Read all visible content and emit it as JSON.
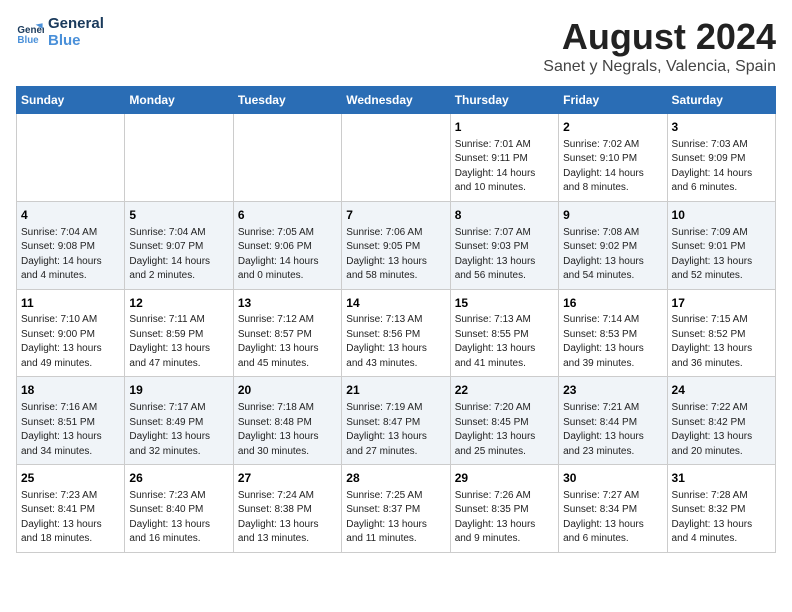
{
  "header": {
    "logo_line1": "General",
    "logo_line2": "Blue",
    "main_title": "August 2024",
    "subtitle": "Sanet y Negrals, Valencia, Spain"
  },
  "days_of_week": [
    "Sunday",
    "Monday",
    "Tuesday",
    "Wednesday",
    "Thursday",
    "Friday",
    "Saturday"
  ],
  "weeks": [
    {
      "row_class": "",
      "days": [
        {
          "num": "",
          "info": ""
        },
        {
          "num": "",
          "info": ""
        },
        {
          "num": "",
          "info": ""
        },
        {
          "num": "",
          "info": ""
        },
        {
          "num": "1",
          "info": "Sunrise: 7:01 AM\nSunset: 9:11 PM\nDaylight: 14 hours\nand 10 minutes."
        },
        {
          "num": "2",
          "info": "Sunrise: 7:02 AM\nSunset: 9:10 PM\nDaylight: 14 hours\nand 8 minutes."
        },
        {
          "num": "3",
          "info": "Sunrise: 7:03 AM\nSunset: 9:09 PM\nDaylight: 14 hours\nand 6 minutes."
        }
      ]
    },
    {
      "row_class": "alt-row",
      "days": [
        {
          "num": "4",
          "info": "Sunrise: 7:04 AM\nSunset: 9:08 PM\nDaylight: 14 hours\nand 4 minutes."
        },
        {
          "num": "5",
          "info": "Sunrise: 7:04 AM\nSunset: 9:07 PM\nDaylight: 14 hours\nand 2 minutes."
        },
        {
          "num": "6",
          "info": "Sunrise: 7:05 AM\nSunset: 9:06 PM\nDaylight: 14 hours\nand 0 minutes."
        },
        {
          "num": "7",
          "info": "Sunrise: 7:06 AM\nSunset: 9:05 PM\nDaylight: 13 hours\nand 58 minutes."
        },
        {
          "num": "8",
          "info": "Sunrise: 7:07 AM\nSunset: 9:03 PM\nDaylight: 13 hours\nand 56 minutes."
        },
        {
          "num": "9",
          "info": "Sunrise: 7:08 AM\nSunset: 9:02 PM\nDaylight: 13 hours\nand 54 minutes."
        },
        {
          "num": "10",
          "info": "Sunrise: 7:09 AM\nSunset: 9:01 PM\nDaylight: 13 hours\nand 52 minutes."
        }
      ]
    },
    {
      "row_class": "",
      "days": [
        {
          "num": "11",
          "info": "Sunrise: 7:10 AM\nSunset: 9:00 PM\nDaylight: 13 hours\nand 49 minutes."
        },
        {
          "num": "12",
          "info": "Sunrise: 7:11 AM\nSunset: 8:59 PM\nDaylight: 13 hours\nand 47 minutes."
        },
        {
          "num": "13",
          "info": "Sunrise: 7:12 AM\nSunset: 8:57 PM\nDaylight: 13 hours\nand 45 minutes."
        },
        {
          "num": "14",
          "info": "Sunrise: 7:13 AM\nSunset: 8:56 PM\nDaylight: 13 hours\nand 43 minutes."
        },
        {
          "num": "15",
          "info": "Sunrise: 7:13 AM\nSunset: 8:55 PM\nDaylight: 13 hours\nand 41 minutes."
        },
        {
          "num": "16",
          "info": "Sunrise: 7:14 AM\nSunset: 8:53 PM\nDaylight: 13 hours\nand 39 minutes."
        },
        {
          "num": "17",
          "info": "Sunrise: 7:15 AM\nSunset: 8:52 PM\nDaylight: 13 hours\nand 36 minutes."
        }
      ]
    },
    {
      "row_class": "alt-row",
      "days": [
        {
          "num": "18",
          "info": "Sunrise: 7:16 AM\nSunset: 8:51 PM\nDaylight: 13 hours\nand 34 minutes."
        },
        {
          "num": "19",
          "info": "Sunrise: 7:17 AM\nSunset: 8:49 PM\nDaylight: 13 hours\nand 32 minutes."
        },
        {
          "num": "20",
          "info": "Sunrise: 7:18 AM\nSunset: 8:48 PM\nDaylight: 13 hours\nand 30 minutes."
        },
        {
          "num": "21",
          "info": "Sunrise: 7:19 AM\nSunset: 8:47 PM\nDaylight: 13 hours\nand 27 minutes."
        },
        {
          "num": "22",
          "info": "Sunrise: 7:20 AM\nSunset: 8:45 PM\nDaylight: 13 hours\nand 25 minutes."
        },
        {
          "num": "23",
          "info": "Sunrise: 7:21 AM\nSunset: 8:44 PM\nDaylight: 13 hours\nand 23 minutes."
        },
        {
          "num": "24",
          "info": "Sunrise: 7:22 AM\nSunset: 8:42 PM\nDaylight: 13 hours\nand 20 minutes."
        }
      ]
    },
    {
      "row_class": "",
      "days": [
        {
          "num": "25",
          "info": "Sunrise: 7:23 AM\nSunset: 8:41 PM\nDaylight: 13 hours\nand 18 minutes."
        },
        {
          "num": "26",
          "info": "Sunrise: 7:23 AM\nSunset: 8:40 PM\nDaylight: 13 hours\nand 16 minutes."
        },
        {
          "num": "27",
          "info": "Sunrise: 7:24 AM\nSunset: 8:38 PM\nDaylight: 13 hours\nand 13 minutes."
        },
        {
          "num": "28",
          "info": "Sunrise: 7:25 AM\nSunset: 8:37 PM\nDaylight: 13 hours\nand 11 minutes."
        },
        {
          "num": "29",
          "info": "Sunrise: 7:26 AM\nSunset: 8:35 PM\nDaylight: 13 hours\nand 9 minutes."
        },
        {
          "num": "30",
          "info": "Sunrise: 7:27 AM\nSunset: 8:34 PM\nDaylight: 13 hours\nand 6 minutes."
        },
        {
          "num": "31",
          "info": "Sunrise: 7:28 AM\nSunset: 8:32 PM\nDaylight: 13 hours\nand 4 minutes."
        }
      ]
    }
  ]
}
